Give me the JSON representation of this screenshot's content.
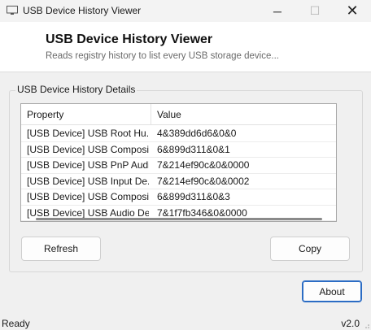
{
  "window": {
    "title": "USB Device History Viewer",
    "icon": "monitor-icon",
    "controls": {
      "minimize": "─",
      "maximize": "☐",
      "close": "✕"
    }
  },
  "header": {
    "title": "USB Device History Viewer",
    "subtitle": "Reads registry history to list every USB storage device..."
  },
  "group": {
    "label": "USB Device History Details"
  },
  "list": {
    "columns": [
      "Property",
      "Value"
    ],
    "rows": [
      {
        "property": "[USB Device] USB Root Hu...",
        "value": "4&389dd6d6&0&0"
      },
      {
        "property": "[USB Device] USB Composi...",
        "value": "6&899d311&0&1"
      },
      {
        "property": "[USB Device] USB PnP Audi...",
        "value": "7&214ef90c&0&0000"
      },
      {
        "property": "[USB Device] USB Input De...",
        "value": "7&214ef90c&0&0002"
      },
      {
        "property": "[USB Device] USB Composi...",
        "value": "6&899d311&0&3"
      },
      {
        "property": "[USB Device] USB Audio De...",
        "value": "7&1f7fb346&0&0000"
      }
    ]
  },
  "buttons": {
    "refresh": "Refresh",
    "copy": "Copy",
    "about": "About"
  },
  "status": {
    "text": "Ready",
    "version": "v2.0"
  },
  "colors": {
    "accent": "#2b6cc4"
  }
}
